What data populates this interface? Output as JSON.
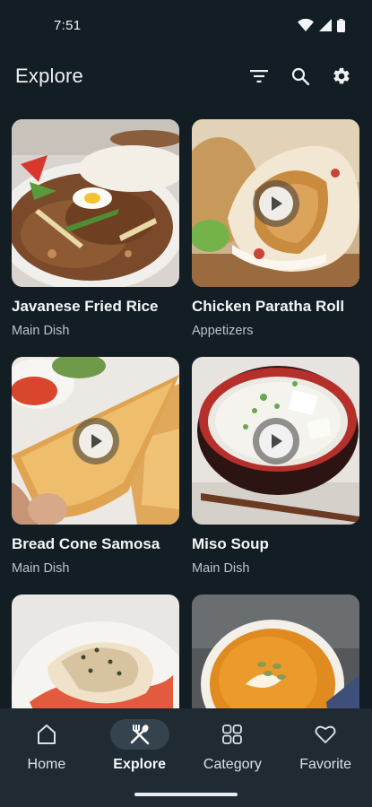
{
  "status_bar": {
    "time": "7:51"
  },
  "app_bar": {
    "title": "Explore",
    "actions": [
      "filter-icon",
      "search-icon",
      "settings-icon"
    ]
  },
  "recipes": [
    {
      "title": "Javanese Fried Rice",
      "category": "Main Dish",
      "has_video": false
    },
    {
      "title": "Chicken Paratha Roll",
      "category": "Appetizers",
      "has_video": true
    },
    {
      "title": "Bread Cone Samosa",
      "category": "Main Dish",
      "has_video": true
    },
    {
      "title": "Miso Soup",
      "category": "Main Dish",
      "has_video": true
    },
    {
      "title": "",
      "category": "",
      "has_video": false
    },
    {
      "title": "",
      "category": "",
      "has_video": false
    }
  ],
  "bottom_nav": {
    "items": [
      {
        "label": "Home",
        "icon": "home-icon"
      },
      {
        "label": "Explore",
        "icon": "fork-knife-icon",
        "active": true
      },
      {
        "label": "Category",
        "icon": "grid-icon"
      },
      {
        "label": "Favorite",
        "icon": "heart-icon"
      }
    ]
  },
  "colors": {
    "background": "#131d24",
    "nav_background": "#1f2a32",
    "nav_active_pill": "#34434d"
  }
}
